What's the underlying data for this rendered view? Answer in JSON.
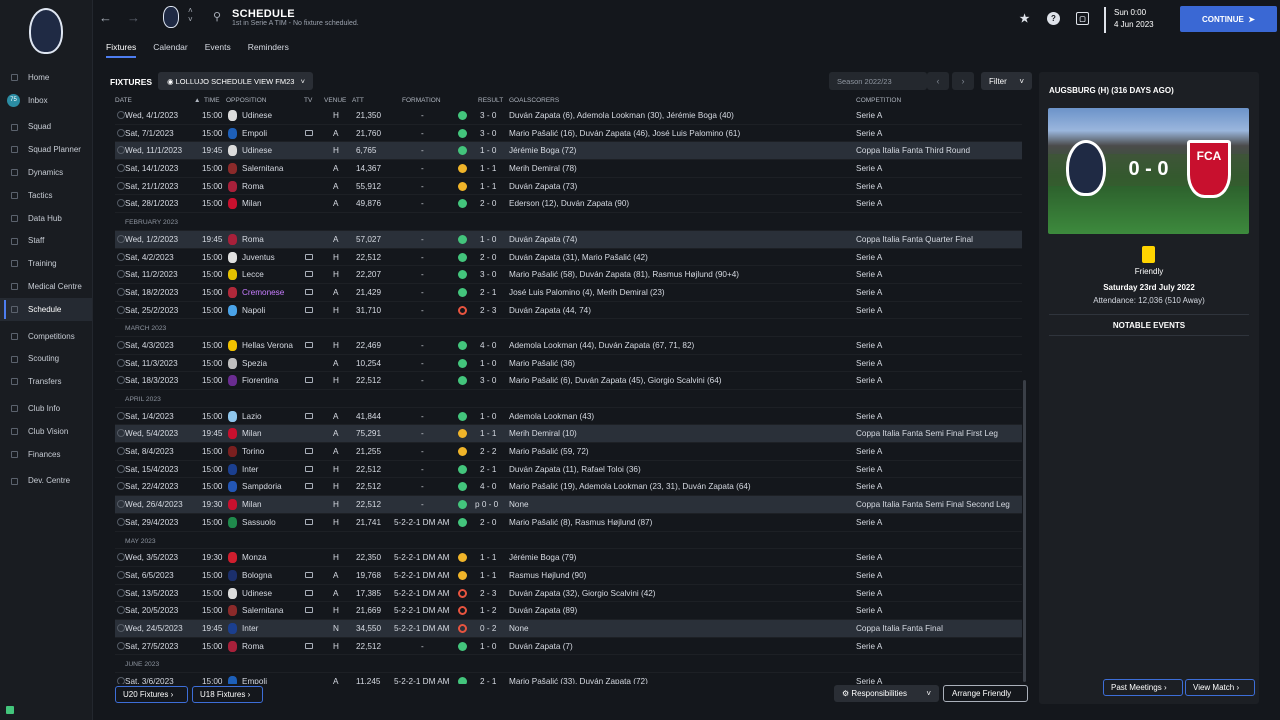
{
  "sidebar": {
    "items": [
      {
        "label": "Home"
      },
      {
        "label": "Inbox",
        "badge": "75"
      },
      {
        "label": "Squad"
      },
      {
        "label": "Squad Planner"
      },
      {
        "label": "Dynamics"
      },
      {
        "label": "Tactics"
      },
      {
        "label": "Data Hub"
      },
      {
        "label": "Staff"
      },
      {
        "label": "Training"
      },
      {
        "label": "Medical Centre"
      },
      {
        "label": "Schedule",
        "active": true
      },
      {
        "label": "Competitions"
      },
      {
        "label": "Scouting"
      },
      {
        "label": "Transfers"
      },
      {
        "label": "Club Info"
      },
      {
        "label": "Club Vision"
      },
      {
        "label": "Finances"
      },
      {
        "label": "Dev. Centre"
      }
    ]
  },
  "header": {
    "title": "SCHEDULE",
    "subtitle": "1st in Serie A TIM - No fixture scheduled.",
    "tabs": [
      {
        "label": "Fixtures",
        "active": true
      },
      {
        "label": "Calendar"
      },
      {
        "label": "Events"
      },
      {
        "label": "Reminders"
      }
    ],
    "datetime": {
      "time": "Sun 0:00",
      "date": "4 Jun 2023"
    },
    "continue_label": "CONTINUE"
  },
  "toolbar": {
    "title": "FIXTURES",
    "view": "LOLLUJO SCHEDULE VIEW FM23",
    "season": "Season 2022/23",
    "filter": "Filter"
  },
  "columns": [
    "DATE",
    "TIME",
    "OPPOSITION",
    "TV",
    "VENUE",
    "ATT",
    "FORMATION",
    "RESULT",
    "GOALSCORERS",
    "COMPETITION"
  ],
  "rows": [
    {
      "date": "Wed, 4/1/2023",
      "time": "15:00",
      "opp": "Udinese",
      "tv": false,
      "venue": "H",
      "att": "21,350",
      "form": "-",
      "res": "W",
      "score": "3 - 0",
      "scorers": "Duván Zapata (6), Ademola Lookman (30), Jérémie Boga (40)",
      "comp": "Serie A",
      "crest": "#dcdcdc"
    },
    {
      "date": "Sat, 7/1/2023",
      "time": "15:00",
      "opp": "Empoli",
      "tv": true,
      "venue": "A",
      "att": "21,760",
      "form": "-",
      "res": "W",
      "score": "3 - 0",
      "scorers": "Mario Pašalić (16), Duván Zapata (46), José Luis Palomino (61)",
      "comp": "Serie A",
      "crest": "#1d5fb8"
    },
    {
      "date": "Wed, 11/1/2023",
      "time": "19:45",
      "opp": "Udinese",
      "tv": false,
      "venue": "H",
      "att": "6,765",
      "form": "-",
      "res": "W",
      "score": "1 - 0",
      "scorers": "Jérémie Boga (72)",
      "comp": "Coppa Italia Fanta Third Round",
      "hl": true,
      "crest": "#dcdcdc"
    },
    {
      "date": "Sat, 14/1/2023",
      "time": "15:00",
      "opp": "Salernitana",
      "tv": false,
      "venue": "A",
      "att": "14,367",
      "form": "-",
      "res": "D",
      "score": "1 - 1",
      "scorers": "Merih Demiral (78)",
      "comp": "Serie A",
      "crest": "#8b2a2a"
    },
    {
      "date": "Sat, 21/1/2023",
      "time": "15:00",
      "opp": "Roma",
      "tv": false,
      "venue": "A",
      "att": "55,912",
      "form": "-",
      "res": "D",
      "score": "1 - 1",
      "scorers": "Duván Zapata (73)",
      "comp": "Serie A",
      "crest": "#a8203a"
    },
    {
      "date": "Sat, 28/1/2023",
      "time": "15:00",
      "opp": "Milan",
      "tv": false,
      "venue": "A",
      "att": "49,876",
      "form": "-",
      "res": "W",
      "score": "2 - 0",
      "scorers": "Ederson (12), Duván Zapata (90)",
      "comp": "Serie A",
      "crest": "#c8102e"
    },
    {
      "section": "FEBRUARY 2023"
    },
    {
      "date": "Wed, 1/2/2023",
      "time": "19:45",
      "opp": "Roma",
      "tv": false,
      "venue": "A",
      "att": "57,027",
      "form": "-",
      "res": "W",
      "score": "1 - 0",
      "scorers": "Duván Zapata (74)",
      "comp": "Coppa Italia Fanta Quarter Final",
      "hl": true,
      "crest": "#a8203a"
    },
    {
      "date": "Sat, 4/2/2023",
      "time": "15:00",
      "opp": "Juventus",
      "tv": true,
      "venue": "H",
      "att": "22,512",
      "form": "-",
      "res": "W",
      "score": "2 - 0",
      "scorers": "Duván Zapata (31), Mario Pašalić (42)",
      "comp": "Serie A",
      "crest": "#e0e0e0"
    },
    {
      "date": "Sat, 11/2/2023",
      "time": "15:00",
      "opp": "Lecce",
      "tv": true,
      "venue": "H",
      "att": "22,207",
      "form": "-",
      "res": "W",
      "score": "3 - 0",
      "scorers": "Mario Pašalić (58), Duván Zapata (81), Rasmus Højlund (90+4)",
      "comp": "Serie A",
      "crest": "#e6c200"
    },
    {
      "date": "Sat, 18/2/2023",
      "time": "15:00",
      "opp": "Cremonese",
      "tv": true,
      "venue": "A",
      "att": "21,429",
      "form": "-",
      "res": "W",
      "score": "2 - 1",
      "scorers": "José Luis Palomino (4), Merih Demiral (23)",
      "comp": "Serie A",
      "crest": "#b0283a",
      "purple": true
    },
    {
      "date": "Sat, 25/2/2023",
      "time": "15:00",
      "opp": "Napoli",
      "tv": true,
      "venue": "H",
      "att": "31,710",
      "form": "-",
      "res": "L",
      "score": "2 - 3",
      "scorers": "Duván Zapata (44, 74)",
      "comp": "Serie A",
      "crest": "#4aa3e8"
    },
    {
      "section": "MARCH 2023"
    },
    {
      "date": "Sat, 4/3/2023",
      "time": "15:00",
      "opp": "Hellas Verona",
      "tv": true,
      "venue": "H",
      "att": "22,469",
      "form": "-",
      "res": "W",
      "score": "4 - 0",
      "scorers": "Ademola Lookman (44), Duván Zapata (67, 71, 82)",
      "comp": "Serie A",
      "crest": "#f2c200"
    },
    {
      "date": "Sat, 11/3/2023",
      "time": "15:00",
      "opp": "Spezia",
      "tv": false,
      "venue": "A",
      "att": "10,254",
      "form": "-",
      "res": "W",
      "score": "1 - 0",
      "scorers": "Mario Pašalić (36)",
      "comp": "Serie A",
      "crest": "#bfbfbf"
    },
    {
      "date": "Sat, 18/3/2023",
      "time": "15:00",
      "opp": "Fiorentina",
      "tv": true,
      "venue": "H",
      "att": "22,512",
      "form": "-",
      "res": "W",
      "score": "3 - 0",
      "scorers": "Mario Pašalić (6), Duván Zapata (45), Giorgio Scalvini (64)",
      "comp": "Serie A",
      "crest": "#6a2c91"
    },
    {
      "section": "APRIL 2023"
    },
    {
      "date": "Sat, 1/4/2023",
      "time": "15:00",
      "opp": "Lazio",
      "tv": true,
      "venue": "A",
      "att": "41,844",
      "form": "-",
      "res": "W",
      "score": "1 - 0",
      "scorers": "Ademola Lookman (43)",
      "comp": "Serie A",
      "crest": "#8fc6ec"
    },
    {
      "date": "Wed, 5/4/2023",
      "time": "19:45",
      "opp": "Milan",
      "tv": false,
      "venue": "A",
      "att": "75,291",
      "form": "-",
      "res": "D",
      "score": "1 - 1",
      "scorers": "Merih Demiral (10)",
      "comp": "Coppa Italia Fanta Semi Final First Leg",
      "hl": true,
      "crest": "#c8102e"
    },
    {
      "date": "Sat, 8/4/2023",
      "time": "15:00",
      "opp": "Torino",
      "tv": true,
      "venue": "A",
      "att": "21,255",
      "form": "-",
      "res": "D",
      "score": "2 - 2",
      "scorers": "Mario Pašalić (59, 72)",
      "comp": "Serie A",
      "crest": "#7a1f1f"
    },
    {
      "date": "Sat, 15/4/2023",
      "time": "15:00",
      "opp": "Inter",
      "tv": true,
      "venue": "H",
      "att": "22,512",
      "form": "-",
      "res": "W",
      "score": "2 - 1",
      "scorers": "Duván Zapata (11), Rafael Toloi (36)",
      "comp": "Serie A",
      "crest": "#1b3f8f"
    },
    {
      "date": "Sat, 22/4/2023",
      "time": "15:00",
      "opp": "Sampdoria",
      "tv": true,
      "venue": "H",
      "att": "22,512",
      "form": "-",
      "res": "W",
      "score": "4 - 0",
      "scorers": "Mario Pašalić (19), Ademola Lookman (23, 31), Duván Zapata (64)",
      "comp": "Serie A",
      "crest": "#2356b5"
    },
    {
      "date": "Wed, 26/4/2023",
      "time": "19:30",
      "opp": "Milan",
      "tv": false,
      "venue": "H",
      "att": "22,512",
      "form": "-",
      "res": "N",
      "score": "p 0 - 0",
      "scorers": "None",
      "comp": "Coppa Italia Fanta Semi Final Second Leg",
      "hl": true,
      "crest": "#c8102e"
    },
    {
      "date": "Sat, 29/4/2023",
      "time": "15:00",
      "opp": "Sassuolo",
      "tv": true,
      "venue": "H",
      "att": "21,741",
      "form": "5-2-2-1 DM AM",
      "res": "W",
      "score": "2 - 0",
      "scorers": "Mario Pašalić (8), Rasmus Højlund (87)",
      "comp": "Serie A",
      "crest": "#1f8a4c"
    },
    {
      "section": "MAY 2023"
    },
    {
      "date": "Wed, 3/5/2023",
      "time": "19:30",
      "opp": "Monza",
      "tv": false,
      "venue": "H",
      "att": "22,350",
      "form": "5-2-2-1 DM AM",
      "res": "D",
      "score": "1 - 1",
      "scorers": "Jérémie Boga (79)",
      "comp": "Serie A",
      "crest": "#d01e2e"
    },
    {
      "date": "Sat, 6/5/2023",
      "time": "15:00",
      "opp": "Bologna",
      "tv": true,
      "venue": "A",
      "att": "19,768",
      "form": "5-2-2-1 DM AM",
      "res": "D",
      "score": "1 - 1",
      "scorers": "Rasmus Højlund (90)",
      "comp": "Serie A",
      "crest": "#1b2f6b"
    },
    {
      "date": "Sat, 13/5/2023",
      "time": "15:00",
      "opp": "Udinese",
      "tv": true,
      "venue": "A",
      "att": "17,385",
      "form": "5-2-2-1 DM AM",
      "res": "L",
      "score": "2 - 3",
      "scorers": "Duván Zapata (32), Giorgio Scalvini (42)",
      "comp": "Serie A",
      "crest": "#dcdcdc"
    },
    {
      "date": "Sat, 20/5/2023",
      "time": "15:00",
      "opp": "Salernitana",
      "tv": true,
      "venue": "H",
      "att": "21,669",
      "form": "5-2-2-1 DM AM",
      "res": "L",
      "score": "1 - 2",
      "scorers": "Duván Zapata (89)",
      "comp": "Serie A",
      "crest": "#8b2a2a"
    },
    {
      "date": "Wed, 24/5/2023",
      "time": "19:45",
      "opp": "Inter",
      "tv": false,
      "venue": "N",
      "att": "34,550",
      "form": "5-2-2-1 DM AM",
      "res": "L",
      "score": "0 - 2",
      "scorers": "None",
      "comp": "Coppa Italia Fanta Final",
      "hl": true,
      "crest": "#1b3f8f"
    },
    {
      "date": "Sat, 27/5/2023",
      "time": "15:00",
      "opp": "Roma",
      "tv": true,
      "venue": "H",
      "att": "22,512",
      "form": "-",
      "res": "W",
      "score": "1 - 0",
      "scorers": "Duván Zapata (7)",
      "comp": "Serie A",
      "crest": "#a8203a"
    },
    {
      "section": "JUNE 2023"
    },
    {
      "date": "Sat, 3/6/2023",
      "time": "15:00",
      "opp": "Empoli",
      "tv": false,
      "venue": "A",
      "att": "11,245",
      "form": "5-2-2-1 DM AM",
      "res": "W",
      "score": "2 - 1",
      "scorers": "Mario Pašalić (33), Duván Zapata (72)",
      "comp": "Serie A",
      "crest": "#1d5fb8"
    }
  ],
  "bottom": {
    "u20": "U20 Fixtures",
    "u18": "U18 Fixtures",
    "responsibilities": "Responsibilities",
    "arrange": "Arrange Friendly"
  },
  "panel": {
    "title": "AUGSBURG (H) (316 DAYS AGO)",
    "score": "0 - 0",
    "away_crest_text": "FCA",
    "competition": "Friendly",
    "date": "Saturday 23rd July 2022",
    "attendance": "Attendance: 12,036 (510 Away)",
    "notable": "NOTABLE EVENTS",
    "past_meetings": "Past Meetings",
    "view_match": "View Match"
  },
  "colors": {
    "accent": "#3a68d4",
    "win": "#43c57c",
    "draw": "#f0b429",
    "loss": "#e8543f"
  }
}
